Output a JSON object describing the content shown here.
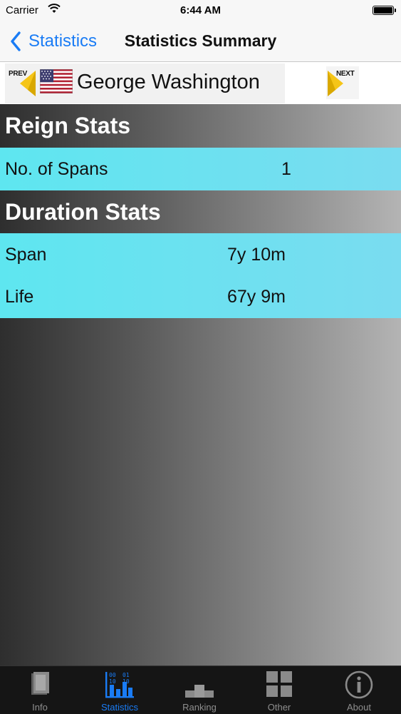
{
  "status_bar": {
    "carrier": "Carrier",
    "time": "6:44 AM"
  },
  "nav": {
    "back_label": "Statistics",
    "title": "Statistics Summary"
  },
  "selector": {
    "prev_label": "PREV",
    "next_label": "NEXT",
    "name": "George Washington"
  },
  "sections": {
    "reign": {
      "title": "Reign Stats",
      "rows": [
        {
          "label": "No. of Spans",
          "value": "1"
        }
      ]
    },
    "duration": {
      "title": "Duration Stats",
      "rows": [
        {
          "label": "Span",
          "value": "7y 10m"
        },
        {
          "label": "Life",
          "value": "67y 9m"
        }
      ]
    }
  },
  "tabs": [
    {
      "label": "Info",
      "icon": "book-icon"
    },
    {
      "label": "Statistics",
      "icon": "statistics-icon",
      "active": true
    },
    {
      "label": "Ranking",
      "icon": "podium-icon"
    },
    {
      "label": "Other",
      "icon": "grid-icon"
    },
    {
      "label": "About",
      "icon": "info-icon"
    }
  ],
  "colors": {
    "accent": "#1a7cf5",
    "row_bg": "#6de2f0",
    "arrow": "#f5c518"
  }
}
